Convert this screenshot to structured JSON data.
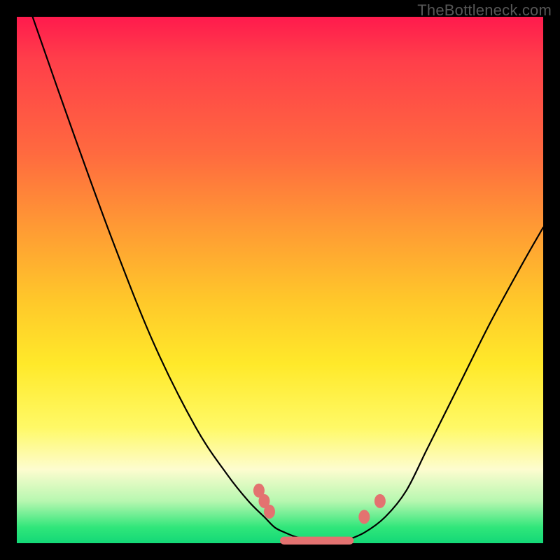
{
  "watermark": "TheBottleneck.com",
  "chart_data": {
    "type": "line",
    "title": "",
    "xlabel": "",
    "ylabel": "",
    "xlim": [
      0,
      100
    ],
    "ylim": [
      0,
      100
    ],
    "grid": false,
    "legend": false,
    "series": [
      {
        "name": "left-curve",
        "color": "#000000",
        "x": [
          3,
          10,
          18,
          26,
          34,
          40,
          44,
          47,
          49,
          51,
          53,
          55,
          58,
          62
        ],
        "y": [
          100,
          80,
          58,
          38,
          22,
          13,
          8,
          5,
          3,
          2,
          1.2,
          0.8,
          0.5,
          0.3
        ]
      },
      {
        "name": "right-curve",
        "color": "#000000",
        "x": [
          62,
          66,
          70,
          74,
          78,
          84,
          90,
          96,
          100
        ],
        "y": [
          0.3,
          2,
          5,
          10,
          18,
          30,
          42,
          53,
          60
        ]
      }
    ],
    "markers": [
      {
        "name": "left-dot-1",
        "x": 46,
        "y": 10
      },
      {
        "name": "left-dot-2",
        "x": 47,
        "y": 8
      },
      {
        "name": "left-dot-3",
        "x": 48,
        "y": 6
      },
      {
        "name": "right-dot-1",
        "x": 66,
        "y": 5
      },
      {
        "name": "right-dot-2",
        "x": 69,
        "y": 8
      }
    ],
    "bottom_band": {
      "color": "#e37270",
      "x_start": 50,
      "x_end": 64,
      "y": 0.5,
      "thickness_pct": 1.5
    }
  }
}
